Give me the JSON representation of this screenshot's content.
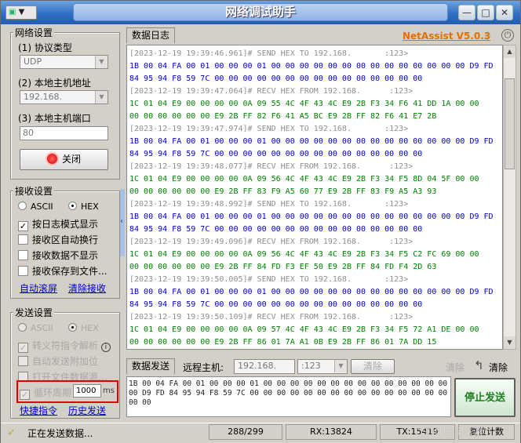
{
  "window": {
    "title": "网络调试助手",
    "app_menu": "▼",
    "controls": [
      "—",
      "□",
      "✕"
    ]
  },
  "net_settings": {
    "group_title": "网络设置",
    "protocol_label": "(1) 协议类型",
    "protocol_value": "UDP",
    "host_addr_label": "(2) 本地主机地址",
    "host_addr_value": "192.168.",
    "host_port_label": "(3) 本地主机端口",
    "host_port_value": "80",
    "close_button": "关闭"
  },
  "recv_settings": {
    "group_title": "接收设置",
    "ascii": "ASCII",
    "hex": "HEX",
    "hex_selected": true,
    "log_mode": "按日志模式显示",
    "auto_wrap": "接收区自动换行",
    "no_display": "接收数据不显示",
    "save_to_file": "接收保存到文件...",
    "auto_scroll": "自动滚屏",
    "clear_recv": "清除接收"
  },
  "send_settings": {
    "group_title": "发送设置",
    "ascii": "ASCII",
    "hex": "HEX",
    "escape_parse": "转义符指令解析",
    "info_icon": "i",
    "auto_append": "自动发送附加位",
    "open_file": "打开文件数据源...",
    "loop_period": "循环周期",
    "loop_value": "1000",
    "loop_unit": "ms",
    "shortcut": "快捷指令",
    "history": "历史发送"
  },
  "log": {
    "tab": "数据日志",
    "brand": "NetAssist V5.0.3",
    "lines": [
      {
        "kind": "time",
        "text": "[2023-12-19 19:39:46.961]# SEND HEX TO 192.168.       :123>"
      },
      {
        "kind": "send",
        "text": "1B 00 04 FA 00 01 00 00 00 01 00 00 00 00 00 00 00 00 00 00 00 00 00 00 D9 FD"
      },
      {
        "kind": "send",
        "text": "84 95 94 F8 59 7C 00 00 00 00 00 00 00 00 00 00 00 00 00 00 00"
      },
      {
        "kind": "time",
        "text": "[2023-12-19 19:39:47.064]# RECV HEX FROM 192.168.      :123>"
      },
      {
        "kind": "recv",
        "text": "1C 01 04 E9 00 00 00 00 0A 09 55 4C 4F 43 4C E9 2B F3 34 F6 41 DD 1A 00 00"
      },
      {
        "kind": "recv",
        "text": "00 00 00 00 00 00 E9 2B FF 82 F6 41 A5 BC E9 2B FF 82 F6 41 E7 2B"
      },
      {
        "kind": "time",
        "text": "[2023-12-19 19:39:47.974]# SEND HEX TO 192.168.       :123>"
      },
      {
        "kind": "send",
        "text": "1B 00 04 FA 00 01 00 00 00 01 00 00 00 00 00 00 00 00 00 00 00 00 00 00 D9 FD"
      },
      {
        "kind": "send",
        "text": "84 95 94 F8 59 7C 00 00 00 00 00 00 00 00 00 00 00 00 00 00 00"
      },
      {
        "kind": "time",
        "text": "[2023-12-19 19:39:48.077]# RECV HEX FROM 192.168.      :123>"
      },
      {
        "kind": "recv",
        "text": "1C 01 04 E9 00 00 00 00 0A 09 56 4C 4F 43 4C E9 2B F3 34 F5 8D 04 5F 00 00"
      },
      {
        "kind": "recv",
        "text": "00 00 00 00 00 00 E9 2B FF 83 F9 A5 60 77 E9 2B FF 83 F9 A5 A3 93"
      },
      {
        "kind": "time",
        "text": "[2023-12-19 19:39:48.992]# SEND HEX TO 192.168.       :123>"
      },
      {
        "kind": "send",
        "text": "1B 00 04 FA 00 01 00 00 00 01 00 00 00 00 00 00 00 00 00 00 00 00 00 00 D9 FD"
      },
      {
        "kind": "send",
        "text": "84 95 94 F8 59 7C 00 00 00 00 00 00 00 00 00 00 00 00 00 00 00"
      },
      {
        "kind": "time",
        "text": "[2023-12-19 19:39:49.096]# RECV HEX FROM 192.168.      :123>"
      },
      {
        "kind": "recv",
        "text": "1C 01 04 E9 00 00 00 00 0A 09 56 4C 4F 43 4C E9 2B F3 34 F5 C2 FC 69 00 00"
      },
      {
        "kind": "recv",
        "text": "00 00 00 00 00 00 E9 2B FF 84 FD F3 EF 50 E9 2B FF 84 FD F4 2D 63"
      },
      {
        "kind": "time",
        "text": "[2023-12-19 19:39:50.005]# SEND HEX TO 192.168.       :123>"
      },
      {
        "kind": "send",
        "text": "1B 00 04 FA 00 01 00 00 00 01 00 00 00 00 00 00 00 00 00 00 00 00 00 00 D9 FD"
      },
      {
        "kind": "send",
        "text": "84 95 94 F8 59 7C 00 00 00 00 00 00 00 00 00 00 00 00 00 00 00"
      },
      {
        "kind": "time",
        "text": "[2023-12-19 19:39:50.109]# RECV HEX FROM 192.168.      :123>"
      },
      {
        "kind": "recv",
        "text": "1C 01 04 E9 00 00 00 00 0A 09 57 4C 4F 43 4C E9 2B F3 34 F5 72 A1 DE 00 00"
      },
      {
        "kind": "recv",
        "text": "00 00 00 00 00 00 E9 2B FF 86 01 7A A1 0B E9 2B FF 86 01 7A DD 15"
      }
    ]
  },
  "send_area": {
    "tab": "数据发送",
    "remote_label": "远程主机:",
    "remote_value": "192.168.",
    "remote_port": ":123",
    "clear_btn": "清除",
    "clear2": "清除",
    "clear3": "清除",
    "payload": "1B 00 04 FA 00 01 00 00 00 01 00 00 00 00 00 00 00 00 00 00 00 00 00 00\n00 D9 FD 84 95 94 F8 59 7C 00 00 00 00 00 00 00 00 00 00 00 00 00 00 00\n00 00",
    "stop_button": "停止发送"
  },
  "statusbar": {
    "status": "正在发送数据...",
    "counter": "288/299",
    "rx": "RX:13824",
    "tx": "TX:15419",
    "reset": "复位计数",
    "watermark": "CSDN @梁岱渊"
  },
  "colors": {
    "send": "#0000c8",
    "recv": "#008000",
    "brand": "#e07000",
    "highlight": "#e00000"
  }
}
